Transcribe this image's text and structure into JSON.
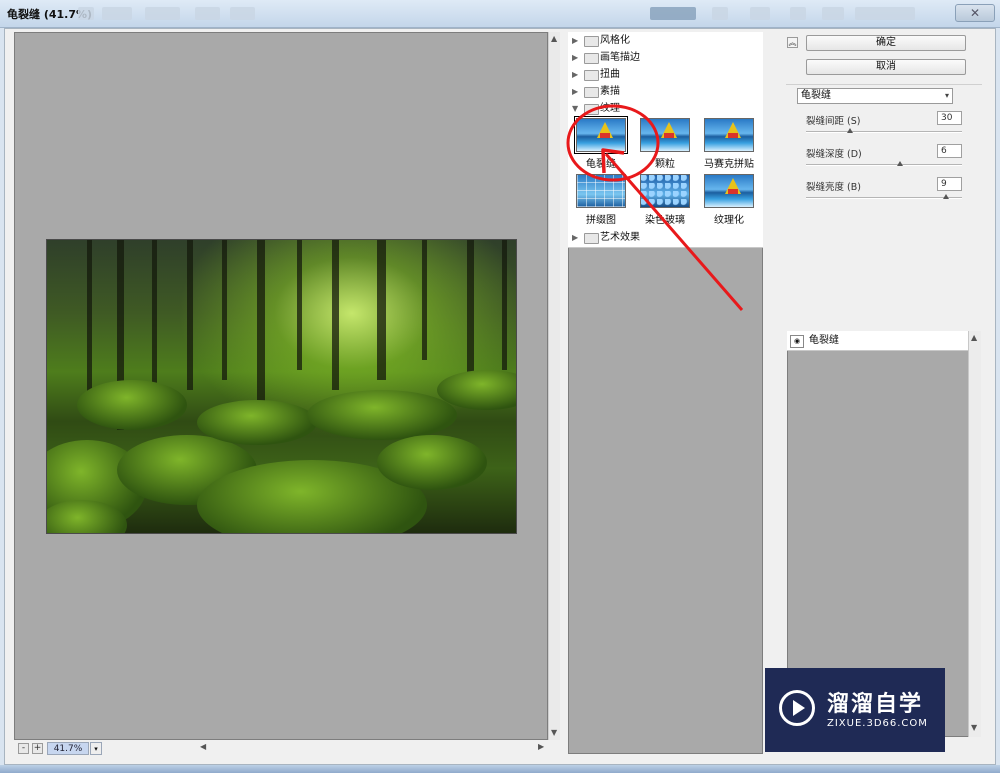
{
  "window": {
    "title": "龟裂缝 (41.7%)",
    "close_glyph": "✕"
  },
  "preview": {
    "zoom": "41.7%",
    "zoom_minus": "-",
    "zoom_plus": "+",
    "zoom_drop": "▾"
  },
  "gallery": {
    "categories_top": [
      {
        "label": "风格化",
        "expanded": false
      },
      {
        "label": "画笔描边",
        "expanded": false
      },
      {
        "label": "扭曲",
        "expanded": false
      },
      {
        "label": "素描",
        "expanded": false
      },
      {
        "label": "纹理",
        "expanded": true
      }
    ],
    "texture_filters": [
      "龟裂缝",
      "颗粒",
      "马赛克拼贴",
      "拼缀图",
      "染色玻璃",
      "纹理化"
    ],
    "selected_filter": "龟裂缝",
    "categories_bottom": [
      {
        "label": "艺术效果",
        "expanded": false
      }
    ]
  },
  "buttons": {
    "ok": "确定",
    "cancel": "取消",
    "collapse": "︽"
  },
  "settings": {
    "filter_select": "龟裂缝",
    "params": [
      {
        "label": "裂缝间距 (S)",
        "value": "30",
        "level": 0.28
      },
      {
        "label": "裂缝深度 (D)",
        "value": "6",
        "level": 0.6
      },
      {
        "label": "裂缝亮度 (B)",
        "value": "9",
        "level": 0.9
      }
    ]
  },
  "layers": {
    "items": [
      {
        "label": "龟裂缝"
      }
    ]
  },
  "watermark": {
    "name": "溜溜自学",
    "url": "ZIXUE.3D66.COM"
  },
  "colors": {
    "annotation_red": "#e8191b",
    "watermark_bg": "#1f2a55",
    "canvas_gray": "#a9a9a9"
  },
  "icons": {
    "expand": "triangle-right-icon",
    "collapse": "triangle-down-icon",
    "folder": "folder-icon",
    "eye": "eye-icon"
  }
}
